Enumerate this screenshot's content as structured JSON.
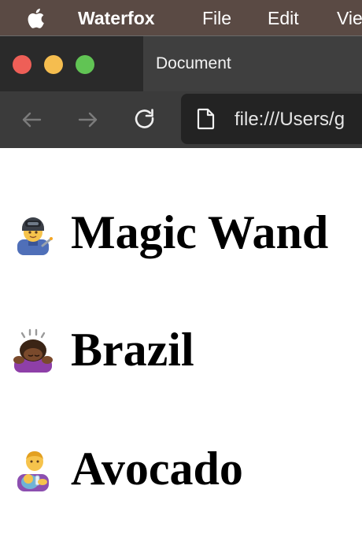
{
  "menubar": {
    "app_name": "Waterfox",
    "items": [
      "File",
      "Edit",
      "Vie"
    ]
  },
  "browser": {
    "tab_title": "Document",
    "url": "file:///Users/g"
  },
  "headings": [
    {
      "emoji": "woman-welder-emoji",
      "text": "Magic Wand"
    },
    {
      "emoji": "woman-bowing-emoji",
      "text": "Brazil"
    },
    {
      "emoji": "man-feeding-baby-emoji",
      "text": "Avocado"
    }
  ],
  "colors": {
    "menubar_bg": "#5a4a44",
    "tabstrip_bg": "#2a2a2a",
    "toolbar_bg": "#3b3b3b",
    "close": "#ee5f57",
    "minimize": "#f5bd4f",
    "maximize": "#61c454"
  }
}
